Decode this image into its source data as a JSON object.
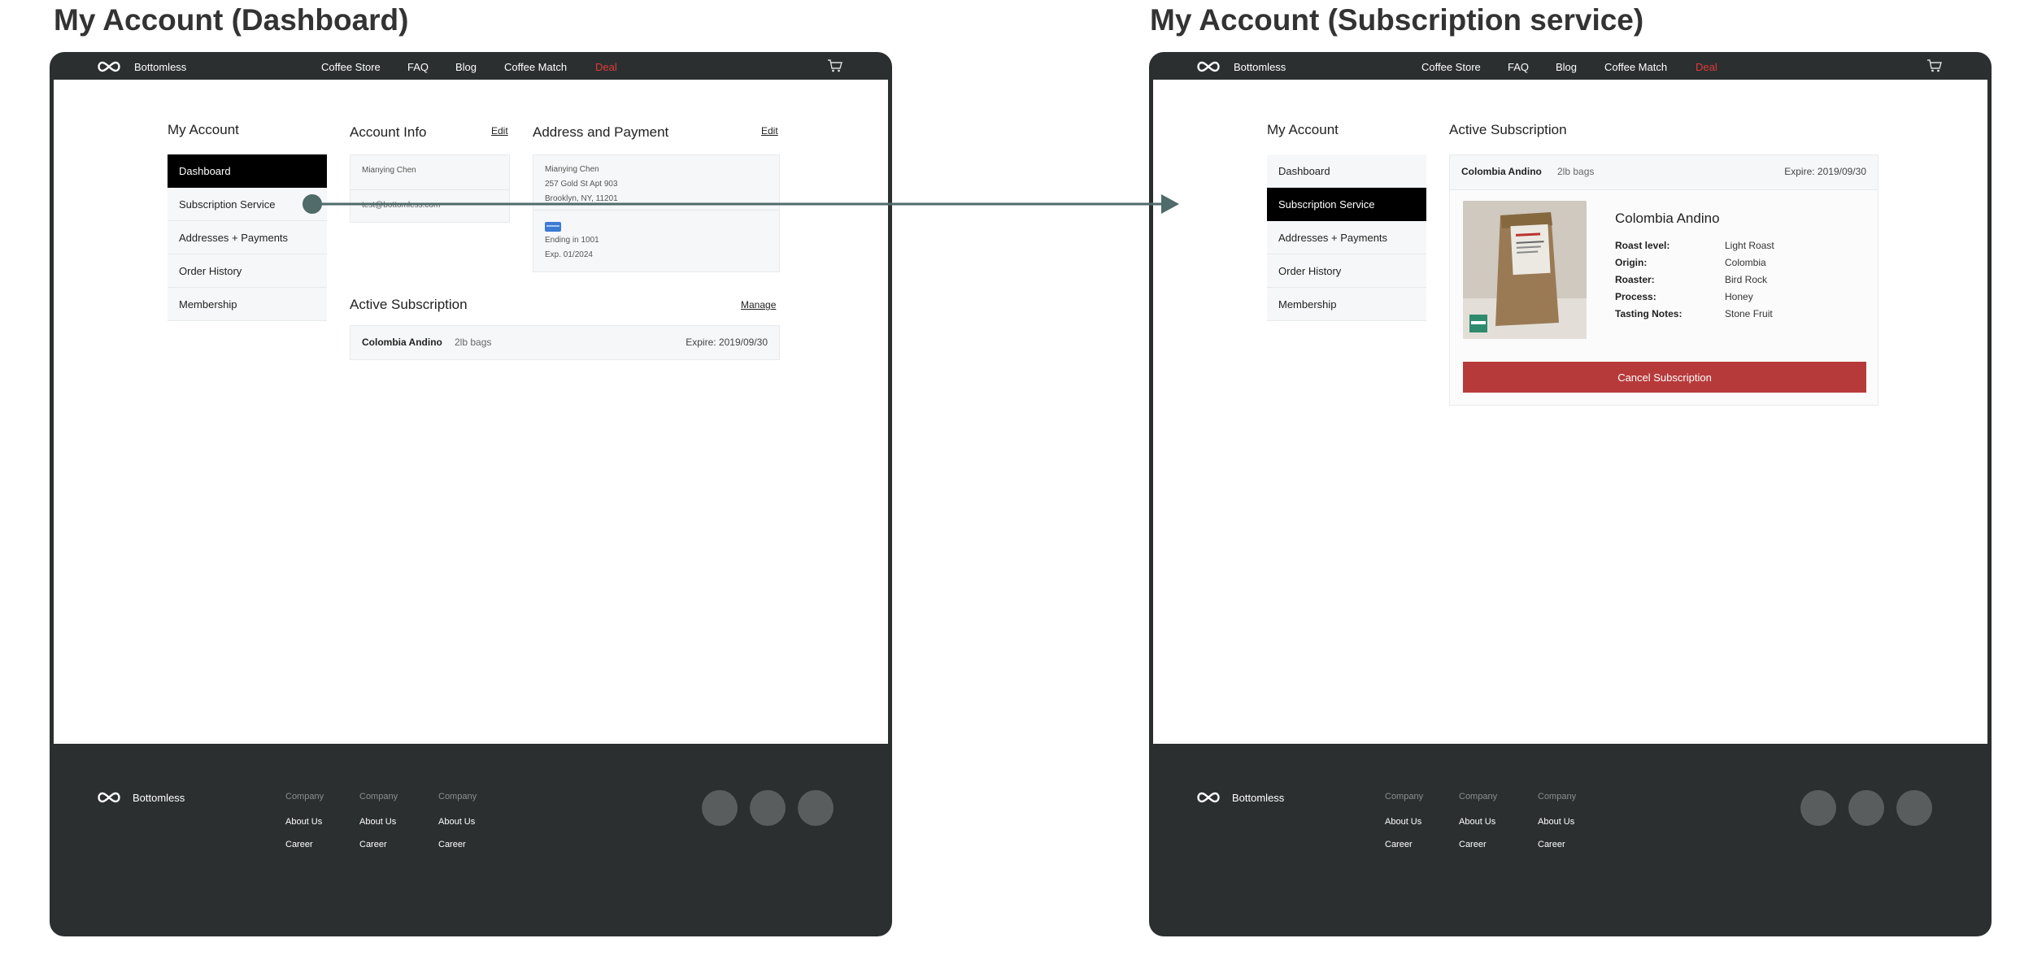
{
  "frames": [
    {
      "title": "My Account (Dashboard)"
    },
    {
      "title": "My Account (Subscription service)"
    }
  ],
  "topnav": {
    "brand": "Bottomless",
    "items": [
      "Coffee Store",
      "FAQ",
      "Blog",
      "Coffee Match"
    ],
    "deal": "Deal"
  },
  "sidebar": {
    "title": "My Account",
    "items": [
      "Dashboard",
      "Subscription Service",
      "Addresses + Payments",
      "Order History",
      "Membership"
    ]
  },
  "dashboard": {
    "account_info": {
      "title": "Account Info",
      "edit": "Edit",
      "name": "Mianying Chen",
      "email": "test@bottomless.com"
    },
    "address_payment": {
      "title": "Address and Payment",
      "edit": "Edit",
      "name": "Mianying Chen",
      "street": "257 Gold St Apt 903",
      "city": "Brooklyn, NY, 11201",
      "card_ending": "Ending in 1001",
      "card_exp": "Exp. 01/2024"
    },
    "active_subscription": {
      "title": "Active Subscription",
      "manage": "Manage",
      "name": "Colombia Andino",
      "qty": "2lb bags",
      "expire": "Expire: 2019/09/30"
    }
  },
  "subscription": {
    "title": "Active Subscription",
    "header_name": "Colombia Andino",
    "header_qty": "2lb bags",
    "header_expire": "Expire: 2019/09/30",
    "product_name": "Colombia Andino",
    "specs": [
      {
        "label": "Roast level:",
        "value": "Light Roast"
      },
      {
        "label": "Origin:",
        "value": "Colombia"
      },
      {
        "label": "Roaster:",
        "value": "Bird Rock"
      },
      {
        "label": "Process:",
        "value": "Honey"
      },
      {
        "label": "Tasting Notes:",
        "value": "Stone Fruit"
      }
    ],
    "cancel": "Cancel Subscription"
  },
  "footer": {
    "brand": "Bottomless",
    "columns": [
      {
        "heading": "Company",
        "links": [
          "About Us",
          "Career"
        ]
      },
      {
        "heading": "Company",
        "links": [
          "About Us",
          "Career"
        ]
      },
      {
        "heading": "Company",
        "links": [
          "About Us",
          "Career"
        ]
      }
    ]
  },
  "colors": {
    "chrome": "#2c2f2f",
    "deal": "#e23a3a",
    "connector": "#4f6b6a",
    "cancel_button": "#b73a3a"
  }
}
